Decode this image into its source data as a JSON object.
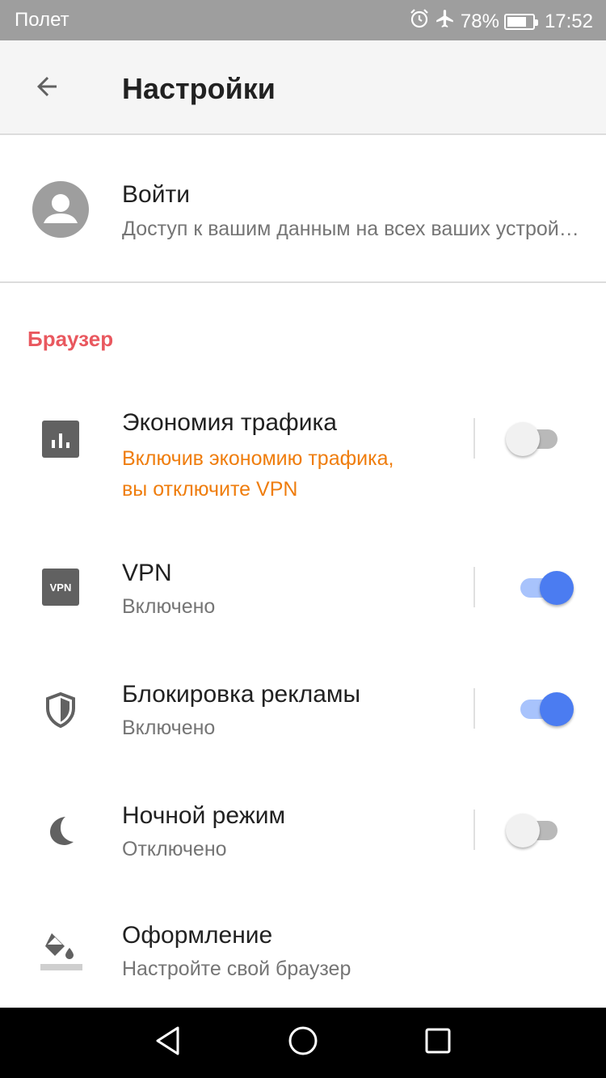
{
  "status_bar": {
    "carrier": "Полет",
    "battery": "78%",
    "battery_level": 0.78,
    "time": "17:52",
    "icons": [
      "alarm-icon",
      "airplane-icon",
      "battery-icon"
    ]
  },
  "app_bar": {
    "title": "Настройки",
    "back_icon": "arrow-back-icon"
  },
  "login": {
    "title": "Войти",
    "subtitle": "Доступ к вашим данным на всех ваших устройствах"
  },
  "section": {
    "label": "Браузер"
  },
  "settings": [
    {
      "id": "traffic",
      "icon": "bar-chart-icon",
      "title": "Экономия трафика",
      "subtitle_lines": [
        "Включив экономию трафика,",
        "вы отключите VPN"
      ],
      "toggle": false
    },
    {
      "id": "vpn",
      "icon": "vpn-icon",
      "icon_text": "VPN",
      "title": "VPN",
      "subtitle": "Включено",
      "toggle": true
    },
    {
      "id": "adblock",
      "icon": "shield-icon",
      "title": "Блокировка рекламы",
      "subtitle": "Включено",
      "toggle": true
    },
    {
      "id": "night",
      "icon": "moon-icon",
      "title": "Ночной режим",
      "subtitle": "Отключено",
      "toggle": false
    },
    {
      "id": "theme",
      "icon": "paint-bucket-icon",
      "title": "Оформление",
      "subtitle": "Настройте свой браузер"
    }
  ],
  "colors": {
    "accent_red": "#e9585f",
    "warning_orange": "#ef7d0d",
    "toggle_on": "#4b7cf1",
    "toggle_on_track": "#a8c3fc"
  },
  "nav_bar": {
    "icons": [
      "back-triangle-icon",
      "home-circle-icon",
      "recents-square-icon"
    ]
  }
}
